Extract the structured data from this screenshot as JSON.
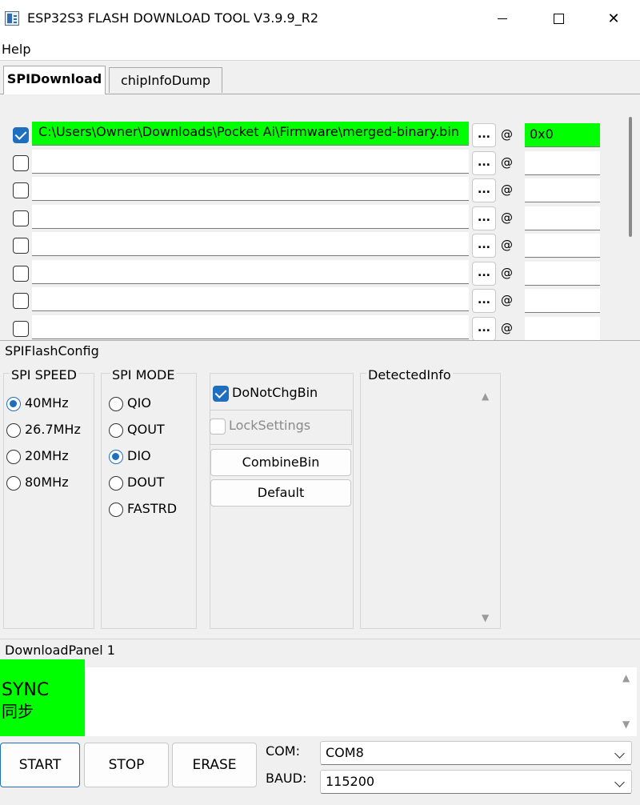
{
  "window": {
    "title": "ESP32S3 FLASH DOWNLOAD TOOL V3.9.9_R2",
    "minimize": "—",
    "maximize": "☐",
    "close": "✕"
  },
  "menu": {
    "help": "Help"
  },
  "tabs": [
    {
      "label": "SPIDownload",
      "active": true
    },
    {
      "label": "chipInfoDump",
      "active": false
    }
  ],
  "files": {
    "browse_label": "...",
    "at_label": "@",
    "rows": [
      {
        "checked": true,
        "path": "C:\\Users\\Owner\\Downloads\\Pocket Ai\\Firmware\\merged-binary.bin",
        "address": "0x0"
      },
      {
        "checked": false,
        "path": "",
        "address": ""
      },
      {
        "checked": false,
        "path": "",
        "address": ""
      },
      {
        "checked": false,
        "path": "",
        "address": ""
      },
      {
        "checked": false,
        "path": "",
        "address": ""
      },
      {
        "checked": false,
        "path": "",
        "address": ""
      },
      {
        "checked": false,
        "path": "",
        "address": ""
      },
      {
        "checked": false,
        "path": "",
        "address": ""
      }
    ]
  },
  "spi_config": {
    "title": "SPIFlashConfig",
    "speed": {
      "title": "SPI SPEED",
      "options": [
        "40MHz",
        "26.7MHz",
        "20MHz",
        "80MHz"
      ],
      "selected": "40MHz"
    },
    "mode": {
      "title": "SPI MODE",
      "options": [
        "QIO",
        "QOUT",
        "DIO",
        "DOUT",
        "FASTRD"
      ],
      "selected": "DIO"
    },
    "do_not_chg_bin": {
      "label": "DoNotChgBin",
      "checked": true
    },
    "lock_settings": {
      "label": "LockSettings",
      "checked": false,
      "disabled": true
    },
    "combine_bin": "CombineBin",
    "default": "Default",
    "detected_info": {
      "title": "DetectedInfo",
      "up": "▲",
      "down": "▼"
    }
  },
  "download_panel": {
    "title": "DownloadPanel 1",
    "status": "SYNC",
    "status_cn": "同步",
    "status_color": "#00ff00",
    "log_up": "▲",
    "log_down": "▼",
    "start": "START",
    "stop": "STOP",
    "erase": "ERASE",
    "com_label": "COM:",
    "com_value": "COM8",
    "baud_label": "BAUD:",
    "baud_value": "115200"
  },
  "colors": {
    "accent": "#1f6fc1",
    "highlight": "#00ff00"
  }
}
